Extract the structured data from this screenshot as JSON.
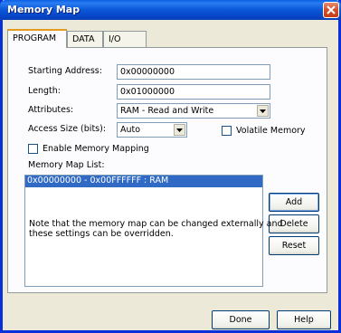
{
  "window": {
    "title": "Memory Map"
  },
  "tabs": [
    {
      "label": "PROGRAM"
    },
    {
      "label": "DATA"
    },
    {
      "label": "I/O"
    }
  ],
  "form": {
    "starting_address_label": "Starting Address:",
    "starting_address_value": "0x00000000",
    "length_label": "Length:",
    "length_value": "0x01000000",
    "attributes_label": "Attributes:",
    "attributes_value": "RAM - Read and Write",
    "access_size_label": "Access Size (bits):",
    "access_size_value": "Auto",
    "volatile_memory_label": "Volatile Memory",
    "volatile_memory_checked": false,
    "enable_mapping_label": "Enable Memory Mapping",
    "enable_mapping_checked": false
  },
  "memory_map_list": {
    "label": "Memory Map List:",
    "items": [
      {
        "text": "0x00000000 - 0x00FFFFFF : RAM",
        "selected": true
      }
    ]
  },
  "list_buttons": {
    "add": "Add",
    "delete": "Delete",
    "reset": "Reset"
  },
  "note": "Note that the memory map can be changed externally and these settings can be overridden.",
  "footer": {
    "done": "Done",
    "help": "Help"
  },
  "icons": {
    "close": "close-icon",
    "dropdown": "chevron-down-icon"
  }
}
